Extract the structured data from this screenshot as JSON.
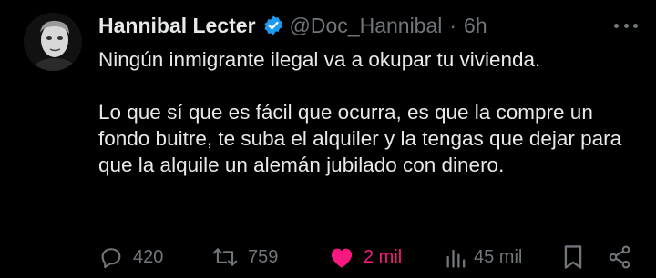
{
  "tweet": {
    "author_name": "Hannibal Lecter",
    "handle": "@Doc_Hannibal",
    "separator": "·",
    "time": "6h",
    "paragraph_1": "Ningún inmigrante ilegal va a okupar tu vivienda.",
    "paragraph_2": "Lo que sí que es fácil que ocurra, es que la compre un fondo buitre, te suba el alquiler y la tengas que dejar para que la alquile un alemán jubilado con dinero."
  },
  "actions": {
    "replies": "420",
    "reposts": "759",
    "likes": "2 mil",
    "views": "45 mil"
  },
  "colors": {
    "background": "#000000",
    "text": "#e7e9ea",
    "muted": "#71767b",
    "verified": "#1d9bf0",
    "like": "#f91880"
  },
  "icons": [
    "verified-badge-icon",
    "more-icon",
    "reply-icon",
    "repost-icon",
    "like-icon",
    "views-icon",
    "bookmark-icon",
    "share-icon"
  ]
}
